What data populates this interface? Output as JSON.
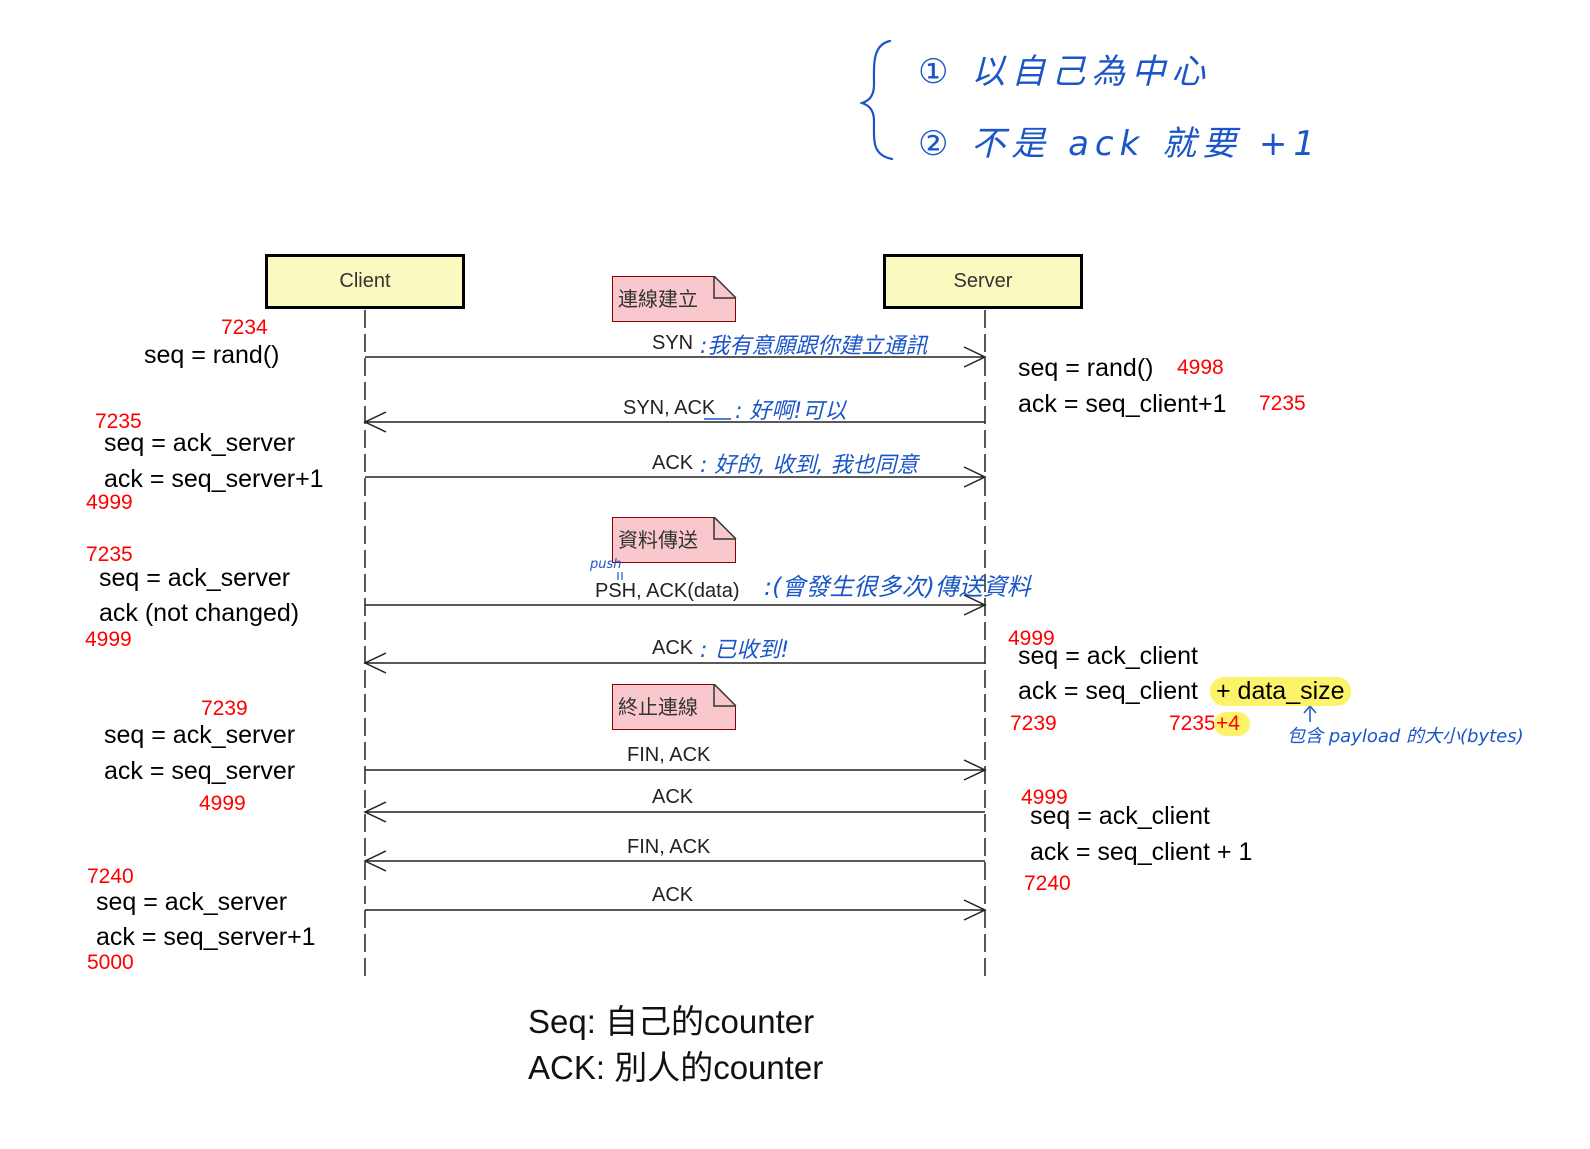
{
  "title_notes": {
    "line1": "① 以自己為中心",
    "line2": "② 不是 ack 就要 +1"
  },
  "participants": {
    "client": "Client",
    "server": "Server"
  },
  "phases": {
    "connect": "連線建立",
    "transfer": "資料傳送",
    "terminate": "終止連線"
  },
  "messages": {
    "syn": "SYN",
    "syn_note": ":我有意願跟你建立通訊",
    "synack": "SYN, ACK",
    "synack_note": ": 好啊!可以",
    "ack1": "ACK",
    "ack1_note": ": 好的, 收到, 我也同意",
    "psh": "PSH, ACK(data)",
    "psh_push": "push",
    "psh_note": ":(會發生很多次)傳送資料",
    "ack2": "ACK",
    "ack2_note": ": 已收到!",
    "fin1": "FIN, ACK",
    "ack3": "ACK",
    "fin2": "FIN, ACK",
    "ack4": "ACK"
  },
  "client_states": {
    "s1": {
      "num": "7234",
      "seq": "seq = rand()"
    },
    "s2": {
      "num_top": "7235",
      "seq": "seq = ack_server",
      "ack": "ack = seq_server+1",
      "num_bottom": "4999"
    },
    "s3": {
      "num_top": "7235",
      "seq": "seq = ack_server",
      "ack": "ack (not changed)",
      "num_bottom": "4999"
    },
    "s4": {
      "num_top": "7239",
      "seq": "seq = ack_server",
      "ack": "ack = seq_server",
      "num_bottom": "4999"
    },
    "s5": {
      "num_top": "7240",
      "seq": "seq = ack_server",
      "ack": "ack = seq_server+1",
      "num_bottom": "5000"
    }
  },
  "server_states": {
    "s1": {
      "seq": "seq = rand()",
      "seq_num": "4998",
      "ack": "ack = seq_client+1",
      "ack_num": "7235"
    },
    "s2": {
      "num_top": "4999",
      "seq": "seq = ack_client",
      "ack": "ack = seq_client",
      "ack_hl": "+ data_size",
      "num_bottom": "7239",
      "num_right": "7235",
      "num_right_hl": "+4",
      "payload_note": "包含 payload 的大小(bytes)"
    },
    "s3": {
      "num_top": "4999",
      "seq": "seq = ack_client",
      "ack": "ack = seq_client + 1",
      "num_bottom": "7240"
    }
  },
  "legend": {
    "seq_line": "Seq: 自己的counter",
    "ack_line": "ACK: 別人的counter"
  }
}
